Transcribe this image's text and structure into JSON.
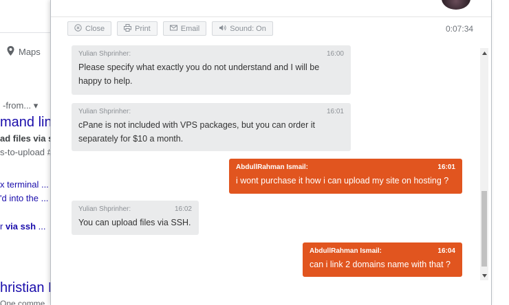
{
  "background": {
    "maps_label": "Maps",
    "from_text": "-from... ▾",
    "result_title": "mand line",
    "bold_line": "ad files via s",
    "small_line": "s-to-upload #",
    "link1": "x terminal ...",
    "link2": "'d into the ...",
    "link3_prefix": "r ",
    "link3_bold": "via ssh",
    "link3_suffix": " ...",
    "result_title2": "hristian K",
    "comment_text": "One comme"
  },
  "toolbar": {
    "close_label": "Close",
    "print_label": "Print",
    "email_label": "Email",
    "sound_label": "Sound: On",
    "timer": "0:07:34"
  },
  "messages": [
    {
      "direction": "in",
      "author": "Yulian Shprinher:",
      "time": "16:00",
      "text": "Please specify what exactly you do not understand and I will be happy to help."
    },
    {
      "direction": "in",
      "author": "Yulian Shprinher:",
      "time": "16:01",
      "text": "cPane is not included with VPS packages, but you can order it separately for $10 a month."
    },
    {
      "direction": "out",
      "author": "AbdullRahman Ismail:",
      "time": "16:01",
      "text": "i wont purchase it how i can upload my site on hosting ?"
    },
    {
      "direction": "in",
      "author": "Yulian Shprinher:",
      "time": "16:02",
      "text": "You can upload files via SSH."
    },
    {
      "direction": "out",
      "author": "AbdullRahman Ismail:",
      "time": "16:04",
      "text": "can i link 2 domains name with that ?"
    }
  ],
  "colors": {
    "outgoing_bubble": "#e1551f",
    "incoming_bubble": "#eaebec",
    "link": "#1a0dab"
  },
  "icons": [
    "close-circle-icon",
    "printer-icon",
    "envelope-icon",
    "speaker-icon",
    "map-pin-icon",
    "scroll-up-icon",
    "scroll-down-icon"
  ]
}
